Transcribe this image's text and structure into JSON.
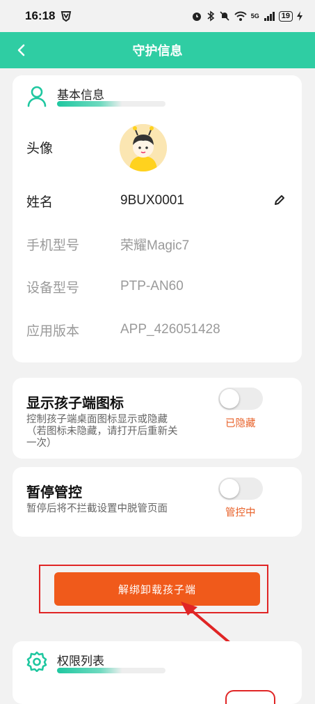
{
  "status_bar": {
    "time": "16:18",
    "network": "5G",
    "battery": "19"
  },
  "app_bar": {
    "title": "守护信息",
    "back_icon": "chevron-left-icon"
  },
  "basic_info": {
    "section_title": "基本信息",
    "icon": "person-icon",
    "rows": {
      "avatar_label": "头像",
      "name_label": "姓名",
      "name_value": "9BUX0001",
      "phone_model_label": "手机型号",
      "phone_model_value": "荣耀Magic7",
      "device_model_label": "设备型号",
      "device_model_value": "PTP-AN60",
      "app_version_label": "应用版本",
      "app_version_value": "APP_426051428"
    }
  },
  "show_icon": {
    "title": "显示孩子端图标",
    "description": "控制孩子端桌面图标显示或隐藏（若图标未隐藏，请打开后重新关一次）",
    "status": "已隐藏",
    "enabled": false
  },
  "pause_control": {
    "title": "暂停管控",
    "description": "暂停后将不拦截设置中脱管页面",
    "status": "管控中",
    "enabled": false
  },
  "unbind_button": {
    "label": "解绑卸载孩子端"
  },
  "permissions": {
    "section_title": "权限列表",
    "icon": "gear-icon"
  },
  "colors": {
    "accent": "#2fcda3",
    "danger_button": "#f05a1b",
    "status_text": "#e8622a",
    "annotation": "#e02525"
  }
}
